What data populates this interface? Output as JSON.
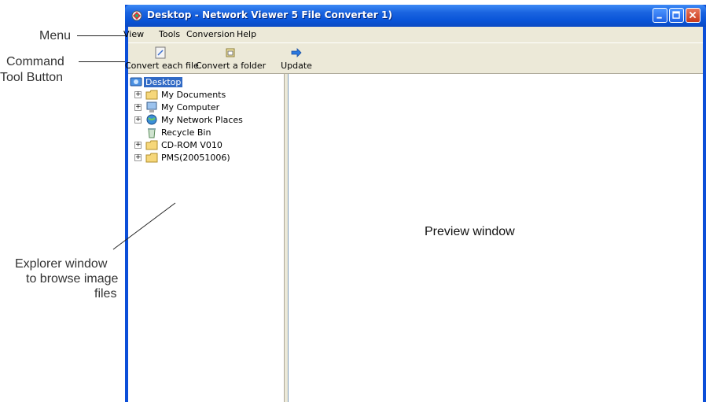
{
  "window": {
    "title": "Desktop - Network Viewer 5  File Converter 1)"
  },
  "menu": {
    "items": [
      {
        "label": "View"
      },
      {
        "label": "Tools"
      },
      {
        "label": "Conversion"
      },
      {
        "label": "Help"
      }
    ]
  },
  "toolbar": {
    "buttons": [
      {
        "label": "Convert each file",
        "icon": "convert-file-icon"
      },
      {
        "label": "Convert a folder",
        "icon": "convert-folder-icon"
      },
      {
        "label": "Update",
        "icon": "update-arrow-icon"
      }
    ]
  },
  "tree": {
    "root": "Desktop",
    "items": [
      {
        "label": "My Documents",
        "icon": "folder-icon"
      },
      {
        "label": "My Computer",
        "icon": "computer-icon"
      },
      {
        "label": "My Network Places",
        "icon": "network-icon"
      },
      {
        "label": "Recycle Bin",
        "icon": "recycle-bin-icon"
      },
      {
        "label": "CD-ROM V010",
        "icon": "folder-icon"
      },
      {
        "label": "PMS(20051006)",
        "icon": "folder-icon"
      }
    ]
  },
  "preview": {
    "label": "Preview window"
  },
  "annotations": {
    "menu": "Menu",
    "command_line1": "Command",
    "command_line2": "Tool Button",
    "explorer_line1": "Explorer window",
    "explorer_line2": "to browse image",
    "explorer_line3": "files"
  }
}
